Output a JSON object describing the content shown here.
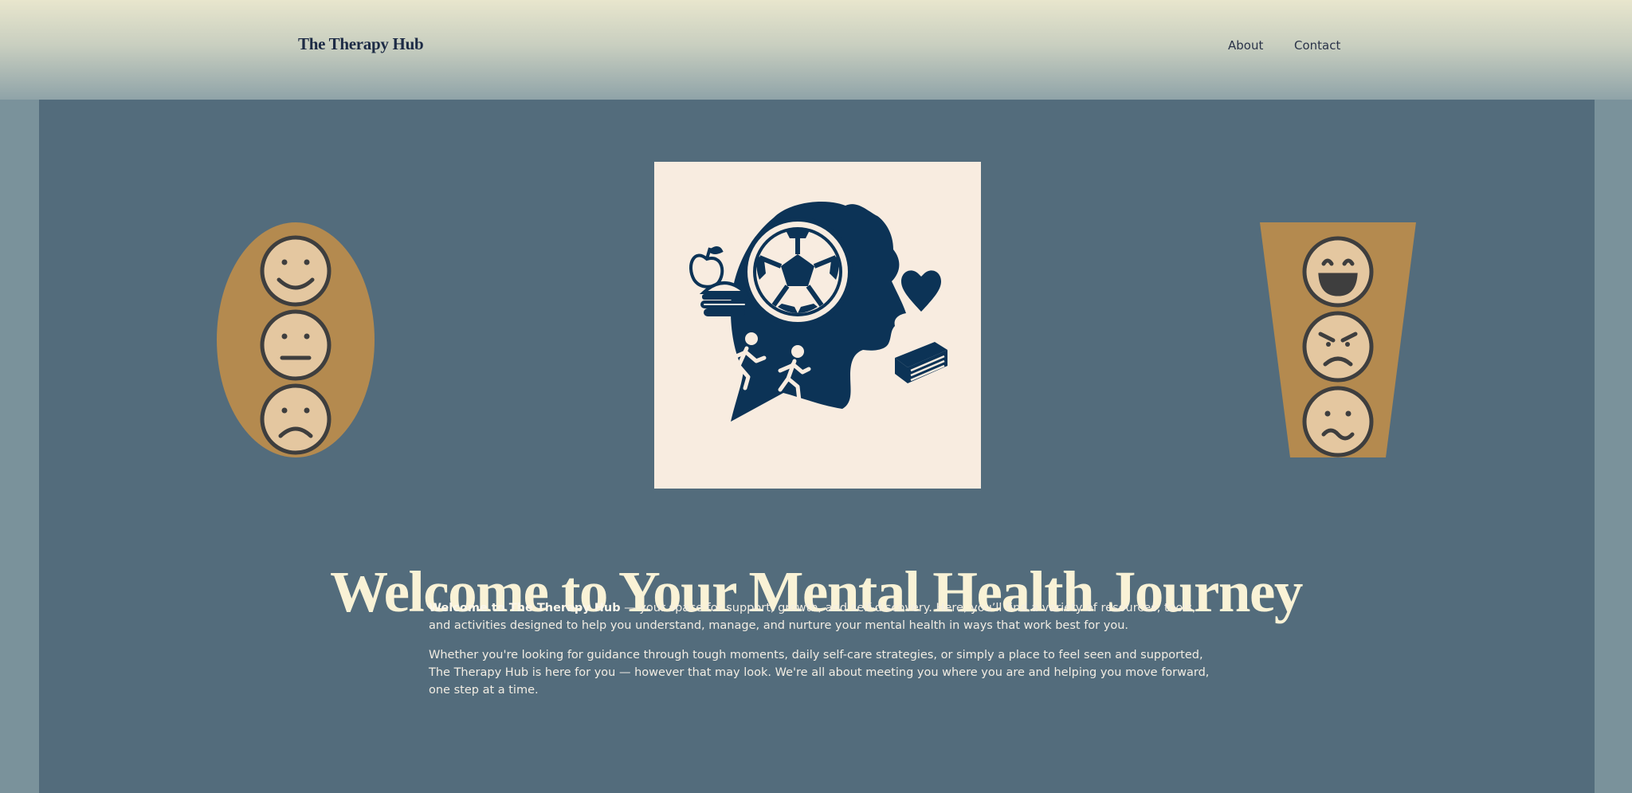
{
  "header": {
    "brand": "The Therapy Hub",
    "nav": [
      {
        "label": "About"
      },
      {
        "label": "Contact"
      }
    ]
  },
  "hero": {
    "headline": "Welcome to Your Mental Health Journey",
    "intro_bold": "Welcome to The Therapy Hub",
    "intro_rest": " — your space for support, growth, and self-discovery. Here, you’ll find a variety of resources, tools, and activities designed to help you understand, manage, and nurture your mental health in ways that work best for you.",
    "paragraph2": "Whether you're looking for guidance through tough moments, daily self-care strategies, or simply a place to feel seen and supported, The Therapy Hub is here for you — however that may look. We're all about meeting you where you are and helping you move forward, one step at a time."
  },
  "images": {
    "left_emotions": [
      "happy-face-icon",
      "neutral-face-icon",
      "sad-face-icon"
    ],
    "right_emotions": [
      "laughing-face-icon",
      "angry-face-icon",
      "uneasy-face-icon"
    ],
    "center": "head-silhouette-with-wellbeing-icons"
  },
  "colors": {
    "panel": "#536c7c",
    "accent_tan": "#b48a4f",
    "face_fill": "#e4c7a0",
    "navy": "#0c3356",
    "cream": "#f9f2d6"
  }
}
